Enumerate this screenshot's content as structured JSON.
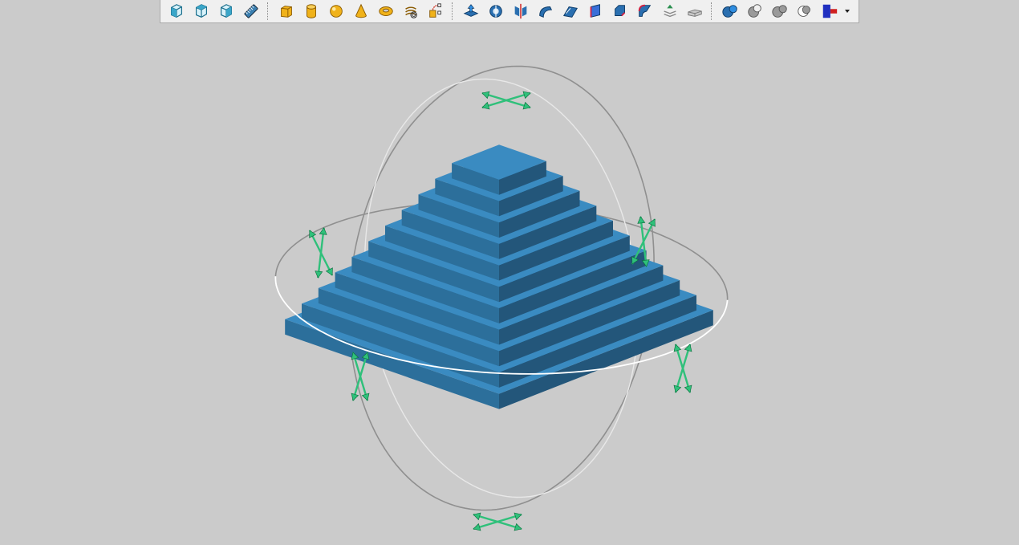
{
  "colors": {
    "viewport_bg": "#cbcbcb",
    "toolbar_bg": "#f0f0f0",
    "pyramid_top": "#3a8bc1",
    "pyramid_right": "#2c6f9b",
    "pyramid_left": "#23567a",
    "gizmo_ring": "#8f8f8f",
    "gizmo_ring_highlight": "#ffffff",
    "gizmo_handle": "#2fc07a"
  },
  "toolbar": {
    "groups": [
      {
        "name": "view-tools",
        "buttons": [
          "view-cube-front-icon",
          "view-cube-iso-icon",
          "view-cube-side-icon",
          "ruler-measure-icon"
        ]
      },
      {
        "name": "primitives",
        "buttons": [
          "box-primitive-icon",
          "cylinder-primitive-icon",
          "sphere-primitive-icon",
          "cone-primitive-icon",
          "torus-primitive-icon",
          "spring-primitive-icon",
          "curve-primitive-icon"
        ]
      },
      {
        "name": "operations",
        "buttons": [
          "extrude-icon",
          "revolve-icon",
          "mirror-icon",
          "sweep-icon",
          "loft-icon",
          "face-icon",
          "chamfer-icon",
          "fillet-icon",
          "layers-icon",
          "plate-icon"
        ]
      },
      {
        "name": "boolean",
        "buttons": [
          "boolean-union-icon",
          "boolean-subtract-icon",
          "boolean-merge-icon",
          "boolean-intersect-icon",
          "t-split-icon"
        ]
      }
    ]
  },
  "scene": {
    "object": "stepped-pyramid",
    "steps": 11,
    "gizmo": "rotation-sphere",
    "handles": 6
  }
}
